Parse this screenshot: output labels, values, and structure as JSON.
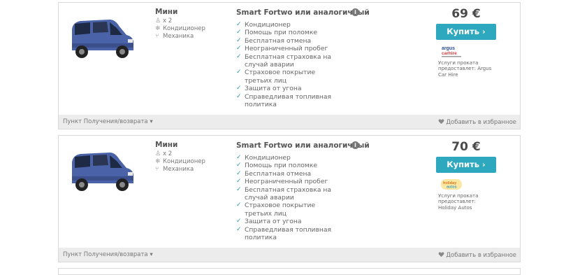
{
  "colors": {
    "accent": "#2ea8bf",
    "check": "#2b9bab",
    "footer_bg": "#ececec"
  },
  "cards": [
    {
      "category": "Мини",
      "specs": [
        {
          "icon": "person-icon",
          "text": "x 2"
        },
        {
          "icon": "snowflake-icon",
          "text": "Кондиционер"
        },
        {
          "icon": "gearshift-icon",
          "text": "Механика"
        }
      ],
      "model": "Smart Fortwo или аналогичный",
      "features": [
        "Кондиционер",
        "Помощь при поломке",
        "Бесплатная отмена",
        "Неограниченный пробег",
        "Бесплатная страховка на случай аварии",
        "Страховое покрытие третьих лиц",
        "Защита от угона",
        "Справедливая топливная политика"
      ],
      "price": "69 €",
      "buy_label": "Купить",
      "provider_logo_text": [
        "argus",
        "carhire"
      ],
      "provider_note": "Услуги проката предоставлет: Argus Car Hire",
      "pickup_label": "Пункт Получения/возврата",
      "favorite_label": "Добавить в избранное"
    },
    {
      "category": "Мини",
      "specs": [
        {
          "icon": "person-icon",
          "text": "x 2"
        },
        {
          "icon": "snowflake-icon",
          "text": "Кондиционер"
        },
        {
          "icon": "gearshift-icon",
          "text": "Механика"
        }
      ],
      "model": "Smart Fortwo или аналогичный",
      "features": [
        "Кондиционер",
        "Помощь при поломке",
        "Бесплатная отмена",
        "Неограниченный пробег",
        "Бесплатная страховка на случай аварии",
        "Страховое покрытие третьих лиц",
        "Защита от угона",
        "Справедливая топливная политика"
      ],
      "price": "70 €",
      "buy_label": "Купить",
      "provider_logo_text": [
        "holiday",
        "autos"
      ],
      "provider_note": "Услуги проката предоставлет: Holiday Autos",
      "pickup_label": "Пункт Получения/возврата",
      "favorite_label": "Добавить в избранное"
    }
  ]
}
